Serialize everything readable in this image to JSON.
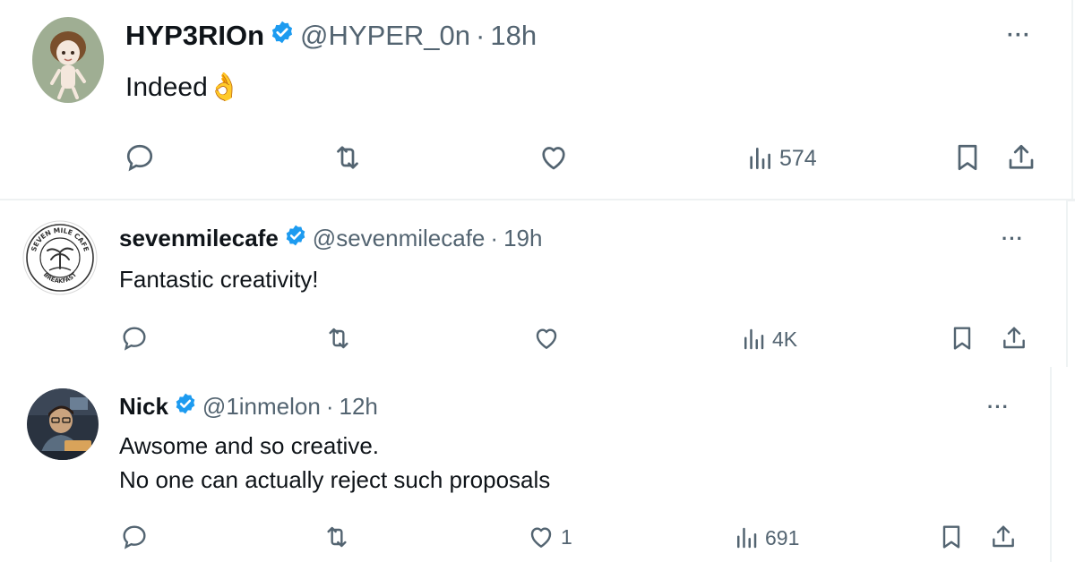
{
  "replies": [
    {
      "name": "HYP3RIOn",
      "handle": "@HYPER_0n",
      "time": "18h",
      "text": "Indeed",
      "emoji": "👌",
      "views": "574",
      "likes": ""
    },
    {
      "name": "sevenmilecafe",
      "handle": "@sevenmilecafe",
      "time": "19h",
      "text": "Fantastic creativity!",
      "views": "4K",
      "likes": "",
      "avatar_text": {
        "top": "SEVEN MILE CAFE",
        "bottom": "BREAKFAST"
      }
    },
    {
      "name": "Nick",
      "handle": "@1inmelon",
      "time": "12h",
      "text_line1": "Awsome and so creative.",
      "text_line2": "No one can actually reject such proposals",
      "views": "691",
      "likes": "1"
    }
  ],
  "separator": "·",
  "more_label": "···",
  "icons": [
    "reply-icon",
    "retweet-icon",
    "like-icon",
    "views-icon",
    "bookmark-icon",
    "share-icon",
    "verified-badge-icon",
    "more-icon"
  ],
  "colors": {
    "verified": "#1d9bf0",
    "muted": "#536471",
    "text": "#0f1419"
  }
}
